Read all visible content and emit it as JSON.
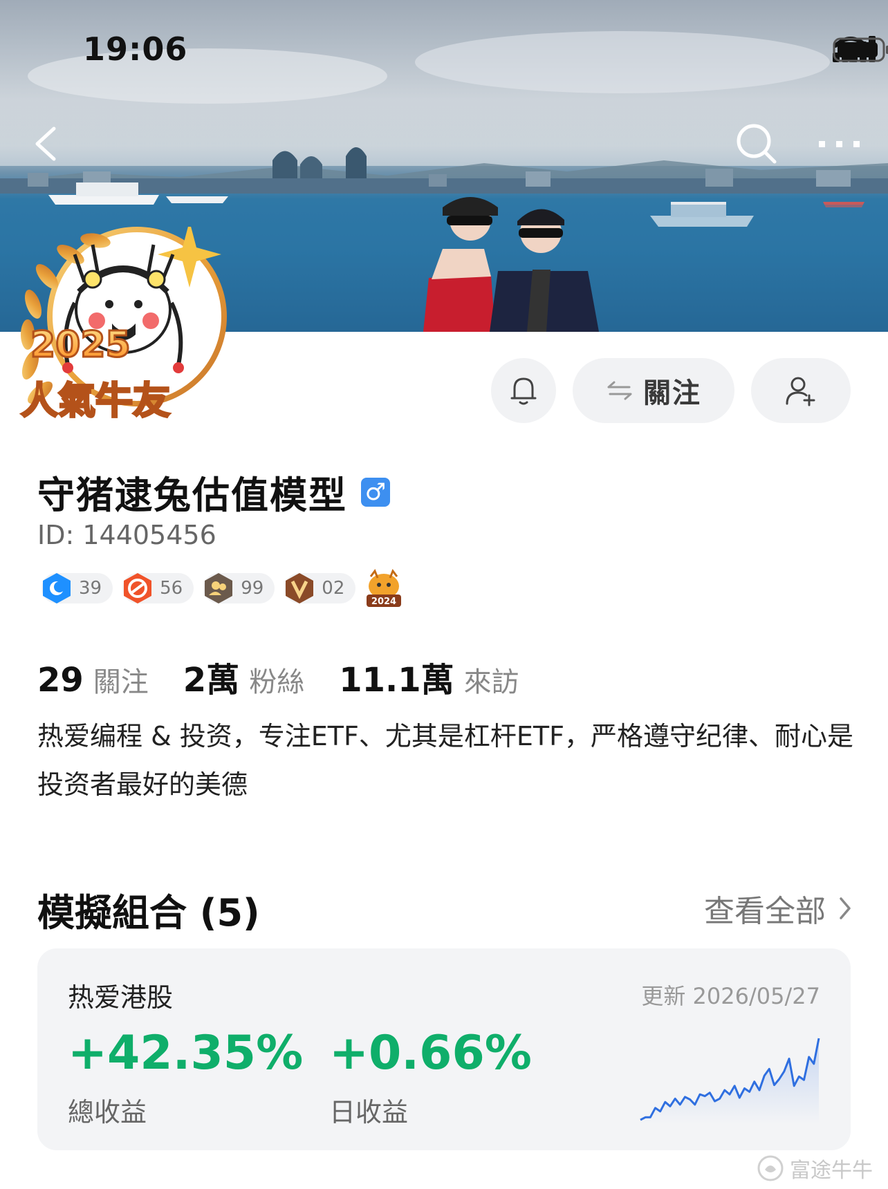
{
  "status_bar": {
    "time": "19:06"
  },
  "avatar": {
    "badge_year": "2025",
    "badge_title": "人氣牛友"
  },
  "profile": {
    "name": "守猪逮兔估值模型",
    "gender_symbol": "♂",
    "id_text": "ID: 14405456",
    "follow_button": "關注"
  },
  "badges": [
    {
      "icon": "shield-blue-icon",
      "count": "39",
      "color": "#1e90ff"
    },
    {
      "icon": "shield-red-icon",
      "count": "56",
      "color": "#f0532a"
    },
    {
      "icon": "people-icon",
      "count": "99",
      "color": "#6b5a4c"
    },
    {
      "icon": "v2-icon",
      "count": "02",
      "color": "#8a4a28"
    },
    {
      "icon": "bull-2024-icon",
      "label": "2024",
      "color": "#f2a22b"
    }
  ],
  "stats": [
    {
      "value": "29",
      "label": "關注"
    },
    {
      "value": "2萬",
      "label": "粉絲"
    },
    {
      "value": "11.1萬",
      "label": "來訪"
    }
  ],
  "bio": "热爱编程 & 投资，专注ETF、尤其是杠杆ETF，严格遵守纪律、耐心是投资者最好的美德",
  "portfolio_section": {
    "title": "模擬組合 (5)",
    "see_all": "查看全部"
  },
  "portfolio_card": {
    "name": "热爱港股",
    "updated": "更新 2026/05/27",
    "total_return": "+42.35%",
    "total_return_label": "總收益",
    "daily_return": "+0.66%",
    "daily_return_label": "日收益",
    "spark_color": "#2f6fe0",
    "spark_values": [
      0,
      3,
      3,
      14,
      10,
      21,
      16,
      25,
      18,
      27,
      24,
      18,
      30,
      28,
      32,
      22,
      25,
      35,
      30,
      40,
      26,
      37,
      33,
      45,
      35,
      52,
      60,
      41,
      48,
      57,
      72,
      40,
      51,
      47,
      74,
      66,
      96
    ]
  },
  "watermark": "富途牛牛",
  "colors": {
    "positive": "#0fae6a",
    "accent": "#3d8ff0"
  }
}
